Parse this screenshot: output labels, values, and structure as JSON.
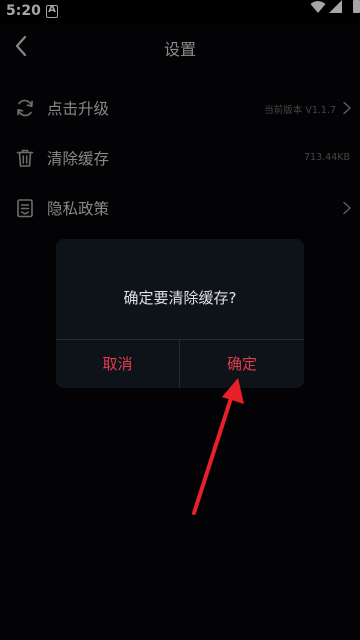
{
  "status_bar": {
    "time": "5:20",
    "notification_letter": "A"
  },
  "header": {
    "title": "设置",
    "back_icon": "chevron-left-icon"
  },
  "settings": {
    "items": [
      {
        "label": "点击升级",
        "value": "当前版本 V1.1.7",
        "icon": "refresh-icon",
        "has_chevron": true
      },
      {
        "label": "清除缓存",
        "value": "713.44KB",
        "icon": "trash-icon",
        "has_chevron": false
      },
      {
        "label": "隐私政策",
        "value": "",
        "icon": "document-icon",
        "has_chevron": true
      }
    ]
  },
  "dialog": {
    "message": "确定要清除缓存?",
    "cancel_label": "取消",
    "confirm_label": "确定"
  },
  "colors": {
    "accent": "#e23b4e",
    "background": "#050508",
    "dialog_bg": "#0e131a",
    "annotation_arrow": "#e8202a"
  }
}
